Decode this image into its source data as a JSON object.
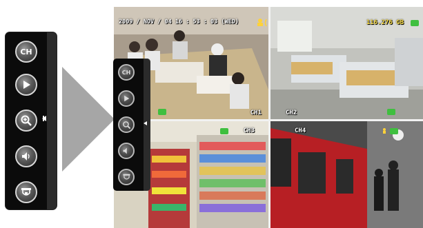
{
  "toolbar": {
    "buttons": [
      {
        "name": "channel",
        "label": "CH",
        "icon": "channel-icon"
      },
      {
        "name": "play",
        "label": "",
        "icon": "play-icon"
      },
      {
        "name": "zoom",
        "label": "",
        "icon": "zoom-in-icon"
      },
      {
        "name": "audio",
        "label": "",
        "icon": "speaker-icon"
      },
      {
        "name": "ptz",
        "label": "",
        "icon": "ptz-camera-icon"
      }
    ],
    "collapse_icon": "collapse-arrow-icon"
  },
  "osd": {
    "datetime": "2009 / NOV / 04  16 : 53 : 03  (WED)",
    "hdd_space": "116.276 GB"
  },
  "channels": [
    {
      "id": "ch1",
      "label": "CH1"
    },
    {
      "id": "ch2",
      "label": "CH2"
    },
    {
      "id": "ch3",
      "label": "CH3"
    },
    {
      "id": "ch4",
      "label": "CH4"
    }
  ],
  "colors": {
    "toolbar_bg": "#0b0b0b",
    "pointer": "#a6a6a6",
    "osd_text": "#ffffff",
    "hdd_text": "#ffe24a",
    "status_green": "#3fbf3f"
  }
}
